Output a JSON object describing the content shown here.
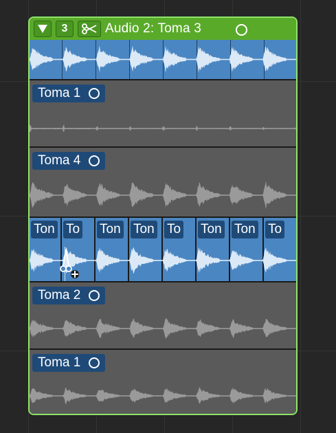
{
  "folder": {
    "header": {
      "disclosure_icon": "triangle-down-icon",
      "take_count": "3",
      "quick_swipe_icon": "scissors-icon",
      "title": "Audio 2: Toma 3",
      "status_icon": "circle-icon"
    },
    "takes": [
      {
        "label": "Toma 1"
      },
      {
        "label": "Toma 4"
      },
      {
        "label": "Toma 2"
      },
      {
        "label": "Toma 1"
      }
    ],
    "selected_segments": [
      "Ton",
      "To",
      "Ton",
      "Ton",
      "To",
      "Ton",
      "Ton",
      "To"
    ],
    "cursor": {
      "icon": "scissors-cursor-icon"
    }
  },
  "colors": {
    "header_bg": "#5aaa2a",
    "folder_border": "#8fe36a",
    "comp_blue": "#4a86c2",
    "take_label_bg": "#1f4a78",
    "lane_gray": "#5a5a5a",
    "waveform_gray": "#9a9a9a",
    "waveform_white": "#dbe9f7"
  }
}
